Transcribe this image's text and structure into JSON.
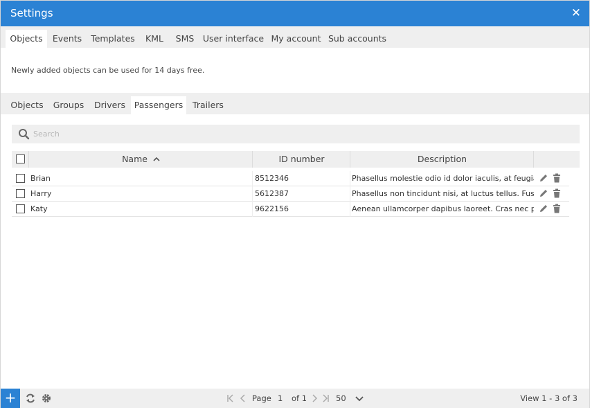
{
  "window": {
    "title": "Settings",
    "close_glyph": "✕"
  },
  "main_tabs": [
    {
      "label": "Objects",
      "active": true
    },
    {
      "label": "Events"
    },
    {
      "label": "Templates"
    },
    {
      "label": "KML"
    },
    {
      "label": "SMS"
    },
    {
      "label": "User interface"
    },
    {
      "label": "My account"
    },
    {
      "label": "Sub accounts"
    }
  ],
  "info_text": "Newly added objects can be used for 14 days free.",
  "sub_tabs": [
    {
      "label": "Objects"
    },
    {
      "label": "Groups"
    },
    {
      "label": "Drivers"
    },
    {
      "label": "Passengers",
      "active": true
    },
    {
      "label": "Trailers"
    }
  ],
  "search": {
    "placeholder": "Search",
    "icon": "search-icon"
  },
  "table": {
    "columns": [
      {
        "label": "Name",
        "sort": "ascending"
      },
      {
        "label": "ID number"
      },
      {
        "label": "Description"
      }
    ],
    "rows": [
      {
        "name": "Brian",
        "id": "8512346",
        "description": "Phasellus molestie odio id dolor iaculis, at feugiat purus"
      },
      {
        "name": "Harry",
        "id": "5612387",
        "description": "Phasellus non tincidunt nisi, at luctus tellus. Fusce a"
      },
      {
        "name": "Katy",
        "id": "9622156",
        "description": "Aenean ullamcorper dapibus laoreet. Cras nec porta"
      }
    ]
  },
  "footer": {
    "add_glyph": "+",
    "page_label": "Page",
    "page_number": "1",
    "of_label": "of 1",
    "page_size": "50",
    "view_text": "View 1 - 3 of 3"
  },
  "colors": {
    "accent": "#2b82d4",
    "bar": "#efefef"
  }
}
